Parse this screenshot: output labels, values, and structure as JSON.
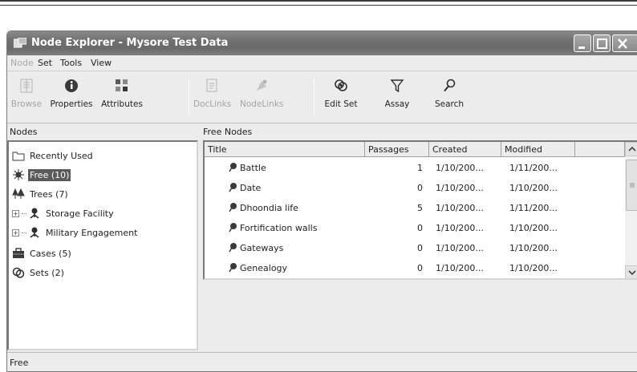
{
  "window": {
    "title": "Node Explorer - Mysore Test Data"
  },
  "menu": {
    "items": [
      {
        "label": "Node",
        "enabled": false
      },
      {
        "label": "Set",
        "enabled": true
      },
      {
        "label": "Tools",
        "enabled": true
      },
      {
        "label": "View",
        "enabled": true
      }
    ]
  },
  "toolbar": {
    "buttons": [
      {
        "label": "Browse",
        "icon": "browse-icon",
        "enabled": false
      },
      {
        "label": "Properties",
        "icon": "info-icon",
        "enabled": true
      },
      {
        "label": "Attributes",
        "icon": "attributes-icon",
        "enabled": true
      },
      {
        "label": "DocLinks",
        "icon": "doclinks-icon",
        "enabled": false
      },
      {
        "label": "NodeLinks",
        "icon": "nodelinks-icon",
        "enabled": false
      },
      {
        "label": "Edit Set",
        "icon": "edit-set-icon",
        "enabled": true
      },
      {
        "label": "Assay",
        "icon": "funnel-icon",
        "enabled": true
      },
      {
        "label": "Search",
        "icon": "search-icon",
        "enabled": true
      }
    ]
  },
  "nodes_panel": {
    "header": "Nodes",
    "items": [
      {
        "label": "Recently Used",
        "icon": "folder-icon",
        "selected": false,
        "expandable": false
      },
      {
        "label": "Free (10)",
        "icon": "free-node-icon",
        "selected": true,
        "expandable": false
      },
      {
        "label": "Trees (7)",
        "icon": "trees-icon",
        "selected": false,
        "expandable": false
      },
      {
        "label": "Storage Facility",
        "icon": "tree-node-icon",
        "selected": false,
        "expandable": true
      },
      {
        "label": "Military Engagement",
        "icon": "tree-node-icon",
        "selected": false,
        "expandable": true
      },
      {
        "label": "Cases (5)",
        "icon": "briefcase-icon",
        "selected": false,
        "expandable": false
      },
      {
        "label": "Sets (2)",
        "icon": "sets-icon",
        "selected": false,
        "expandable": false
      }
    ]
  },
  "free_nodes": {
    "header": "Free Nodes",
    "columns": [
      "Title",
      "Passages",
      "Created",
      "Modified"
    ],
    "rows": [
      {
        "title": "Battle",
        "passages": "1",
        "created": "1/10/200...",
        "modified": "1/11/200..."
      },
      {
        "title": "Date",
        "passages": "0",
        "created": "1/10/200...",
        "modified": "1/10/200..."
      },
      {
        "title": "Dhoondia life",
        "passages": "5",
        "created": "1/10/200...",
        "modified": "1/11/200..."
      },
      {
        "title": "Fortification walls",
        "passages": "0",
        "created": "1/10/200...",
        "modified": "1/10/200..."
      },
      {
        "title": "Gateways",
        "passages": "0",
        "created": "1/10/200...",
        "modified": "1/10/200..."
      },
      {
        "title": "Genealogy",
        "passages": "0",
        "created": "1/10/200...",
        "modified": "1/10/200..."
      }
    ]
  },
  "status": {
    "text": "Free"
  }
}
